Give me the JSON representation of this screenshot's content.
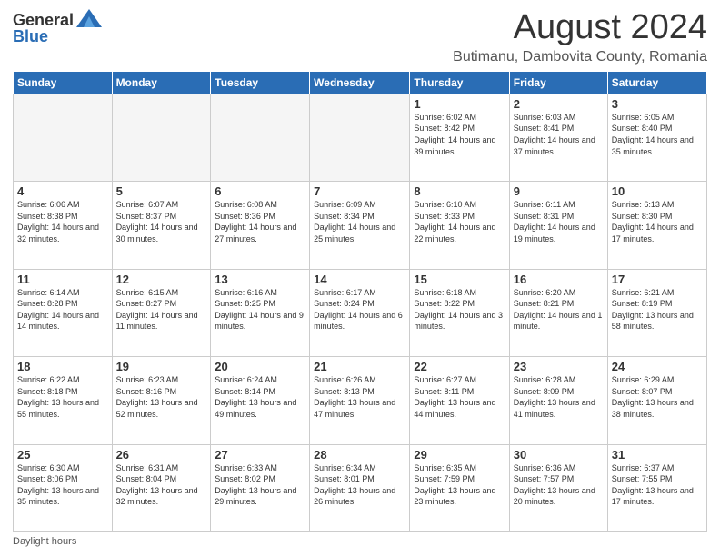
{
  "logo": {
    "general": "General",
    "blue": "Blue"
  },
  "title": "August 2024",
  "location": "Butimanu, Dambovita County, Romania",
  "days_of_week": [
    "Sunday",
    "Monday",
    "Tuesday",
    "Wednesday",
    "Thursday",
    "Friday",
    "Saturday"
  ],
  "footer_text": "Daylight hours",
  "weeks": [
    [
      {
        "day": "",
        "info": ""
      },
      {
        "day": "",
        "info": ""
      },
      {
        "day": "",
        "info": ""
      },
      {
        "day": "",
        "info": ""
      },
      {
        "day": "1",
        "info": "Sunrise: 6:02 AM\nSunset: 8:42 PM\nDaylight: 14 hours and 39 minutes."
      },
      {
        "day": "2",
        "info": "Sunrise: 6:03 AM\nSunset: 8:41 PM\nDaylight: 14 hours and 37 minutes."
      },
      {
        "day": "3",
        "info": "Sunrise: 6:05 AM\nSunset: 8:40 PM\nDaylight: 14 hours and 35 minutes."
      }
    ],
    [
      {
        "day": "4",
        "info": "Sunrise: 6:06 AM\nSunset: 8:38 PM\nDaylight: 14 hours and 32 minutes."
      },
      {
        "day": "5",
        "info": "Sunrise: 6:07 AM\nSunset: 8:37 PM\nDaylight: 14 hours and 30 minutes."
      },
      {
        "day": "6",
        "info": "Sunrise: 6:08 AM\nSunset: 8:36 PM\nDaylight: 14 hours and 27 minutes."
      },
      {
        "day": "7",
        "info": "Sunrise: 6:09 AM\nSunset: 8:34 PM\nDaylight: 14 hours and 25 minutes."
      },
      {
        "day": "8",
        "info": "Sunrise: 6:10 AM\nSunset: 8:33 PM\nDaylight: 14 hours and 22 minutes."
      },
      {
        "day": "9",
        "info": "Sunrise: 6:11 AM\nSunset: 8:31 PM\nDaylight: 14 hours and 19 minutes."
      },
      {
        "day": "10",
        "info": "Sunrise: 6:13 AM\nSunset: 8:30 PM\nDaylight: 14 hours and 17 minutes."
      }
    ],
    [
      {
        "day": "11",
        "info": "Sunrise: 6:14 AM\nSunset: 8:28 PM\nDaylight: 14 hours and 14 minutes."
      },
      {
        "day": "12",
        "info": "Sunrise: 6:15 AM\nSunset: 8:27 PM\nDaylight: 14 hours and 11 minutes."
      },
      {
        "day": "13",
        "info": "Sunrise: 6:16 AM\nSunset: 8:25 PM\nDaylight: 14 hours and 9 minutes."
      },
      {
        "day": "14",
        "info": "Sunrise: 6:17 AM\nSunset: 8:24 PM\nDaylight: 14 hours and 6 minutes."
      },
      {
        "day": "15",
        "info": "Sunrise: 6:18 AM\nSunset: 8:22 PM\nDaylight: 14 hours and 3 minutes."
      },
      {
        "day": "16",
        "info": "Sunrise: 6:20 AM\nSunset: 8:21 PM\nDaylight: 14 hours and 1 minute."
      },
      {
        "day": "17",
        "info": "Sunrise: 6:21 AM\nSunset: 8:19 PM\nDaylight: 13 hours and 58 minutes."
      }
    ],
    [
      {
        "day": "18",
        "info": "Sunrise: 6:22 AM\nSunset: 8:18 PM\nDaylight: 13 hours and 55 minutes."
      },
      {
        "day": "19",
        "info": "Sunrise: 6:23 AM\nSunset: 8:16 PM\nDaylight: 13 hours and 52 minutes."
      },
      {
        "day": "20",
        "info": "Sunrise: 6:24 AM\nSunset: 8:14 PM\nDaylight: 13 hours and 49 minutes."
      },
      {
        "day": "21",
        "info": "Sunrise: 6:26 AM\nSunset: 8:13 PM\nDaylight: 13 hours and 47 minutes."
      },
      {
        "day": "22",
        "info": "Sunrise: 6:27 AM\nSunset: 8:11 PM\nDaylight: 13 hours and 44 minutes."
      },
      {
        "day": "23",
        "info": "Sunrise: 6:28 AM\nSunset: 8:09 PM\nDaylight: 13 hours and 41 minutes."
      },
      {
        "day": "24",
        "info": "Sunrise: 6:29 AM\nSunset: 8:07 PM\nDaylight: 13 hours and 38 minutes."
      }
    ],
    [
      {
        "day": "25",
        "info": "Sunrise: 6:30 AM\nSunset: 8:06 PM\nDaylight: 13 hours and 35 minutes."
      },
      {
        "day": "26",
        "info": "Sunrise: 6:31 AM\nSunset: 8:04 PM\nDaylight: 13 hours and 32 minutes."
      },
      {
        "day": "27",
        "info": "Sunrise: 6:33 AM\nSunset: 8:02 PM\nDaylight: 13 hours and 29 minutes."
      },
      {
        "day": "28",
        "info": "Sunrise: 6:34 AM\nSunset: 8:01 PM\nDaylight: 13 hours and 26 minutes."
      },
      {
        "day": "29",
        "info": "Sunrise: 6:35 AM\nSunset: 7:59 PM\nDaylight: 13 hours and 23 minutes."
      },
      {
        "day": "30",
        "info": "Sunrise: 6:36 AM\nSunset: 7:57 PM\nDaylight: 13 hours and 20 minutes."
      },
      {
        "day": "31",
        "info": "Sunrise: 6:37 AM\nSunset: 7:55 PM\nDaylight: 13 hours and 17 minutes."
      }
    ]
  ]
}
